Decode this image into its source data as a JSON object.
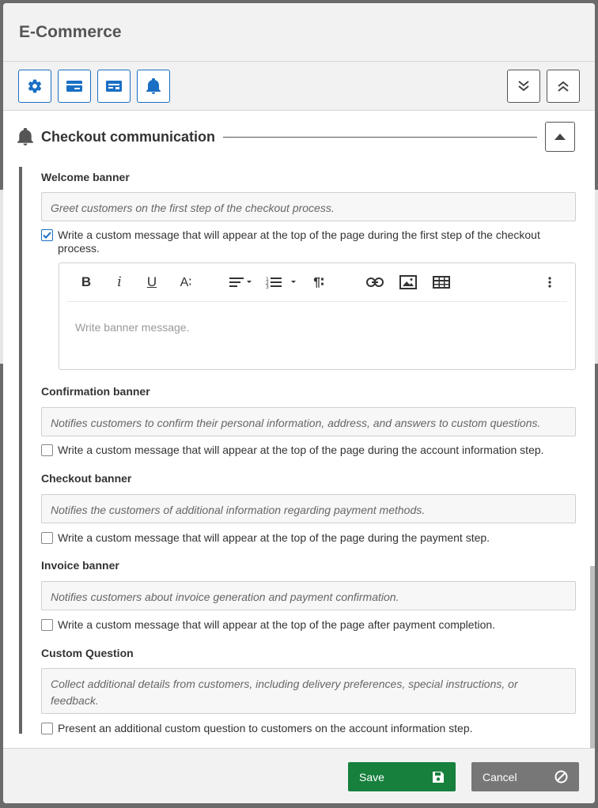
{
  "dialog": {
    "title": "E-Commerce"
  },
  "toolbar": {
    "buttons": [
      {
        "icon": "gear-icon"
      },
      {
        "icon": "credit-card-icon"
      },
      {
        "icon": "payment-card-icon"
      },
      {
        "icon": "bell-icon"
      }
    ],
    "right_buttons": [
      {
        "icon": "expand-all-icon"
      },
      {
        "icon": "collapse-all-icon"
      }
    ]
  },
  "section": {
    "title": "Checkout communication",
    "icon": "bell-icon",
    "fields": [
      {
        "label": "Welcome banner",
        "description": "Greet customers on the first step of the checkout process.",
        "checkbox_label": "Write a custom message that will appear at the top of the page during the first step of the checkout process.",
        "checked": true
      },
      {
        "label": "Confirmation banner",
        "description": "Notifies customers to confirm their personal information, address, and answers to custom questions.",
        "checkbox_label": "Write a custom message that will appear at the top of the page during the account information step.",
        "checked": false
      },
      {
        "label": "Checkout banner",
        "description": "Notifies the customers of additional information regarding payment methods.",
        "checkbox_label": "Write a custom message that will appear at the top of the page during the payment step.",
        "checked": false
      },
      {
        "label": "Invoice banner",
        "description": "Notifies customers about invoice generation and payment confirmation.",
        "checkbox_label": "Write a custom message that will appear at the top of the page after payment completion.",
        "checked": false
      },
      {
        "label": "Custom Question",
        "description": "Collect additional details from customers, including delivery preferences, special instructions, or feedback.",
        "checkbox_label": "Present an additional custom question to customers on the account information step.",
        "checked": false
      }
    ]
  },
  "editor": {
    "placeholder": "Write banner message.",
    "bold": "B",
    "italic": "i",
    "underline": "U",
    "font_size": "A∶",
    "paragraph": "¶∶"
  },
  "footer": {
    "save_label": "Save",
    "cancel_label": "Cancel"
  },
  "colors": {
    "accent": "#1a6fc4",
    "save": "#17803d",
    "cancel": "#777777"
  }
}
